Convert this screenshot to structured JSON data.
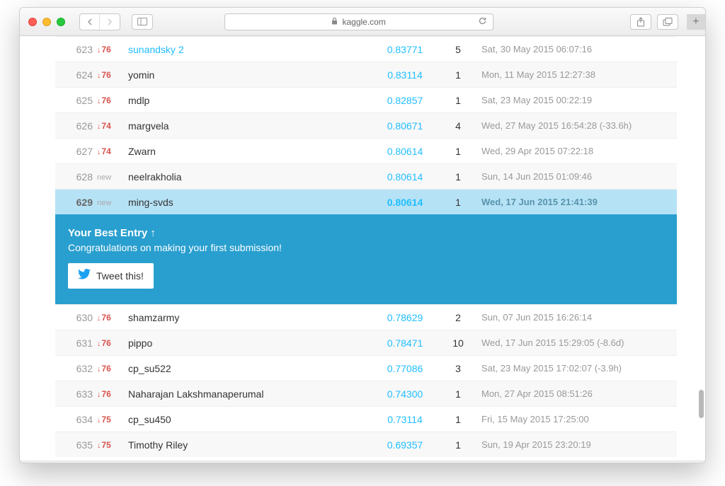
{
  "browser": {
    "url_host": "kaggle.com"
  },
  "leaderboard": {
    "rows_before": [
      {
        "rank": "623",
        "delta_type": "down",
        "delta": "76",
        "team": "sunandsky 2",
        "team_link": true,
        "score": "0.83771",
        "entries": "5",
        "timestamp": "Sat, 30 May 2015 06:07:16",
        "bg": "white"
      },
      {
        "rank": "624",
        "delta_type": "down",
        "delta": "76",
        "team": "yomin",
        "team_link": false,
        "score": "0.83114",
        "entries": "1",
        "timestamp": "Mon, 11 May 2015 12:27:38",
        "bg": "alt"
      },
      {
        "rank": "625",
        "delta_type": "down",
        "delta": "76",
        "team": "mdlp",
        "team_link": false,
        "score": "0.82857",
        "entries": "1",
        "timestamp": "Sat, 23 May 2015 00:22:19",
        "bg": "white"
      },
      {
        "rank": "626",
        "delta_type": "down",
        "delta": "74",
        "team": "margvela",
        "team_link": false,
        "score": "0.80671",
        "entries": "4",
        "timestamp": "Wed, 27 May 2015 16:54:28 (-33.6h)",
        "bg": "alt"
      },
      {
        "rank": "627",
        "delta_type": "down",
        "delta": "74",
        "team": "Zwarn",
        "team_link": false,
        "score": "0.80614",
        "entries": "1",
        "timestamp": "Wed, 29 Apr 2015 07:22:18",
        "bg": "white"
      },
      {
        "rank": "628",
        "delta_type": "new",
        "delta": "new",
        "team": "neelrakholia",
        "team_link": false,
        "score": "0.80614",
        "entries": "1",
        "timestamp": "Sun, 14 Jun 2015 01:09:46",
        "bg": "alt"
      }
    ],
    "highlighted": {
      "rank": "629",
      "delta_type": "new",
      "delta": "new",
      "team": "ming-svds",
      "score": "0.80614",
      "entries": "1",
      "timestamp": "Wed, 17 Jun 2015 21:41:39"
    },
    "callout": {
      "title": "Your Best Entry ↑",
      "subtitle": "Congratulations on making your first submission!",
      "tweet_label": "Tweet this!"
    },
    "rows_after": [
      {
        "rank": "630",
        "delta_type": "down",
        "delta": "76",
        "team": "shamzarmy",
        "team_link": false,
        "score": "0.78629",
        "entries": "2",
        "timestamp": "Sun, 07 Jun 2015 16:26:14",
        "bg": "white"
      },
      {
        "rank": "631",
        "delta_type": "down",
        "delta": "76",
        "team": "pippo",
        "team_link": false,
        "score": "0.78471",
        "entries": "10",
        "timestamp": "Wed, 17 Jun 2015 15:29:05 (-8.6d)",
        "bg": "alt"
      },
      {
        "rank": "632",
        "delta_type": "down",
        "delta": "76",
        "team": "cp_su522",
        "team_link": false,
        "score": "0.77086",
        "entries": "3",
        "timestamp": "Sat, 23 May 2015 17:02:07 (-3.9h)",
        "bg": "white"
      },
      {
        "rank": "633",
        "delta_type": "down",
        "delta": "76",
        "team": "Naharajan Lakshmanaperumal",
        "team_link": false,
        "score": "0.74300",
        "entries": "1",
        "timestamp": "Mon, 27 Apr 2015 08:51:26",
        "bg": "alt"
      },
      {
        "rank": "634",
        "delta_type": "down",
        "delta": "75",
        "team": "cp_su450",
        "team_link": false,
        "score": "0.73114",
        "entries": "1",
        "timestamp": "Fri, 15 May 2015 17:25:00",
        "bg": "white"
      },
      {
        "rank": "635",
        "delta_type": "down",
        "delta": "75",
        "team": "Timothy Riley",
        "team_link": false,
        "score": "0.69357",
        "entries": "1",
        "timestamp": "Sun, 19 Apr 2015 23:20:19",
        "bg": "alt"
      }
    ]
  }
}
